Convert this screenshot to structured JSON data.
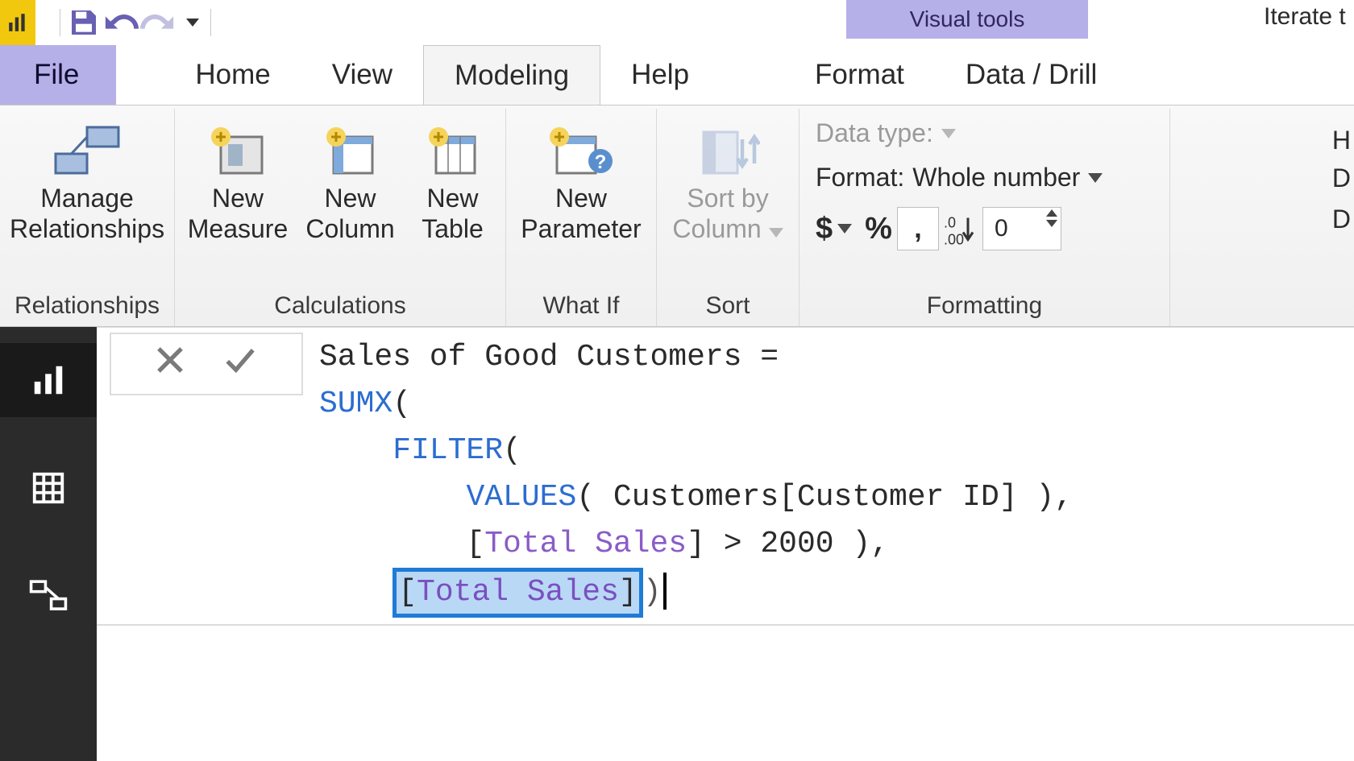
{
  "chrome": {
    "visual_tools": "Visual tools",
    "context_tab_title": "Iterate t"
  },
  "qat": {
    "save": "Save",
    "undo": "Undo",
    "redo": "Redo"
  },
  "tabs": {
    "file": "File",
    "home": "Home",
    "view": "View",
    "modeling": "Modeling",
    "help": "Help",
    "format": "Format",
    "data_drill": "Data / Drill"
  },
  "ribbon": {
    "relationships_group": "Relationships",
    "calculations_group": "Calculations",
    "what_if_group": "What If",
    "sort_group": "Sort",
    "formatting_group": "Formatting",
    "manage_relationships_l1": "Manage",
    "manage_relationships_l2": "Relationships",
    "new_measure_l1": "New",
    "new_measure_l2": "Measure",
    "new_column_l1": "New",
    "new_column_l2": "Column",
    "new_table_l1": "New",
    "new_table_l2": "Table",
    "new_parameter_l1": "New",
    "new_parameter_l2": "Parameter",
    "sort_by_l1": "Sort by",
    "sort_by_l2": "Column",
    "data_type_label": "Data type:",
    "format_label": "Format:",
    "format_value": "Whole number",
    "currency": "$",
    "percent": "%",
    "comma": ",",
    "decimal_places": "0",
    "right_trail_1": "H",
    "right_trail_2": "D",
    "right_trail_3": "D"
  },
  "formula": {
    "measure_name": "Sales of Good Customers =",
    "sumx": "SUMX",
    "filter": "FILTER",
    "values": "VALUES",
    "column_ref": "Customers[Customer ID]",
    "measure_ref": "Total Sales",
    "threshold": "2000",
    "open_paren": "(",
    "close_paren": ")",
    "open_bracket": "[",
    "close_bracket": "]",
    "gt": ">",
    "comma": ",",
    "sp4": "    ",
    "sp8": "        ",
    "sp2": "  "
  },
  "canvas": {
    "bg_word": "Iter"
  },
  "rail": {
    "report": "Report view",
    "data": "Data view",
    "model": "Model view"
  }
}
